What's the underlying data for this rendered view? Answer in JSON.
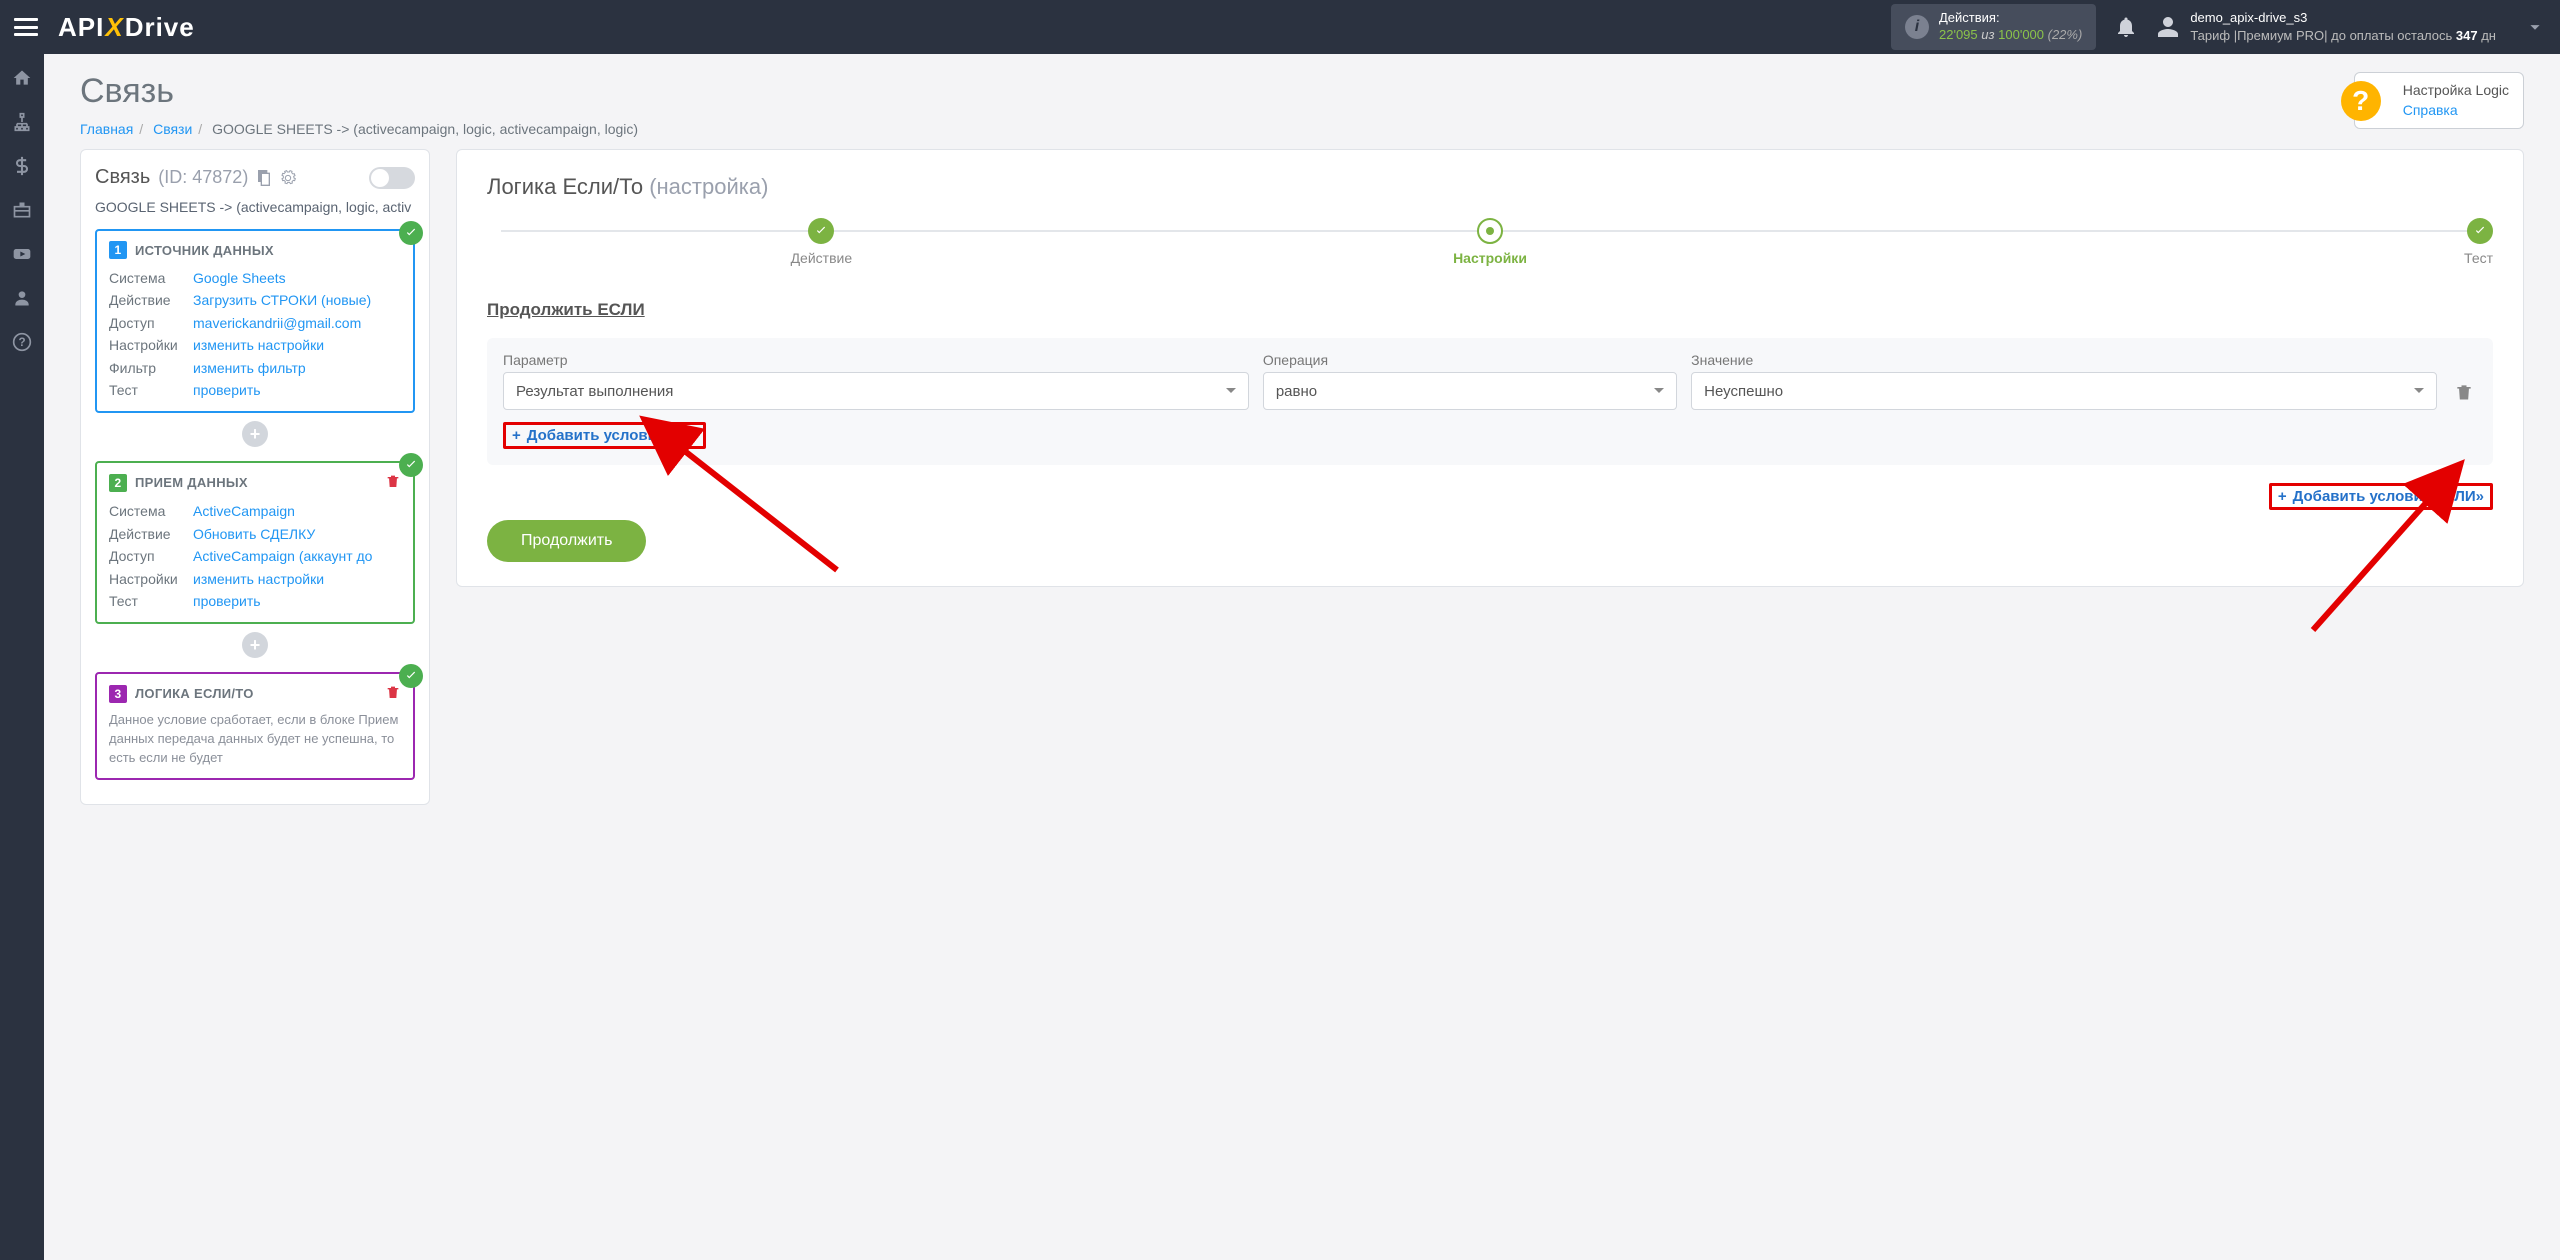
{
  "header": {
    "actions_label": "Действия:",
    "actions_num1": "22'095",
    "actions_mid": " из ",
    "actions_num2": "100'000",
    "actions_pct": " (22%)",
    "user_name": "demo_apix-drive_s3",
    "tariff_prefix": "Тариф |Премиум PRO| до оплаты осталось ",
    "tariff_days": "347",
    "tariff_suffix": " дн"
  },
  "page": {
    "title": "Связь",
    "bc_home": "Главная",
    "bc_links": "Связи",
    "bc_current": "GOOGLE SHEETS -> (activecampaign, logic, activecampaign, logic)",
    "help_l1": "Настройка Logic",
    "help_l2": "Справка"
  },
  "left": {
    "title": "Связь",
    "id": "(ID: 47872)",
    "subtitle": "GOOGLE SHEETS -> (activecampaign, logic, activ",
    "b1": {
      "num": "1",
      "title": "ИСТОЧНИК ДАННЫХ",
      "rows": [
        {
          "k": "Система",
          "v": "Google Sheets"
        },
        {
          "k": "Действие",
          "v": "Загрузить СТРОКИ (новые)"
        },
        {
          "k": "Доступ",
          "v": "maverickandrii@gmail.com"
        },
        {
          "k": "Настройки",
          "v": "изменить настройки"
        },
        {
          "k": "Фильтр",
          "v": "изменить фильтр"
        },
        {
          "k": "Тест",
          "v": "проверить"
        }
      ]
    },
    "b2": {
      "num": "2",
      "title": "ПРИЕМ ДАННЫХ",
      "rows": [
        {
          "k": "Система",
          "v": "ActiveCampaign"
        },
        {
          "k": "Действие",
          "v": "Обновить СДЕЛКУ"
        },
        {
          "k": "Доступ",
          "v": "ActiveCampaign (аккаунт до"
        },
        {
          "k": "Настройки",
          "v": "изменить настройки"
        },
        {
          "k": "Тест",
          "v": "проверить"
        }
      ]
    },
    "b3": {
      "num": "3",
      "title": "ЛОГИКА ЕСЛИ/ТО",
      "desc": "Данное условие сработает, если в блоке Прием данных передача данных будет не успешна, то есть если не будет"
    }
  },
  "panel": {
    "title_main": "Логика Если/То ",
    "title_grey": "(настройка)",
    "step1": "Действие",
    "step2": "Настройки",
    "step3": "Тест",
    "section": "Продолжить ЕСЛИ",
    "col_param": "Параметр",
    "col_op": "Операция",
    "col_val": "Значение",
    "sel_param": "Результат выполнения",
    "sel_op": "равно",
    "sel_val": "Неуспешно",
    "add_and": "Добавить условие «И»",
    "add_or": "Добавить условие «ИЛИ»",
    "continue": "Продолжить"
  }
}
